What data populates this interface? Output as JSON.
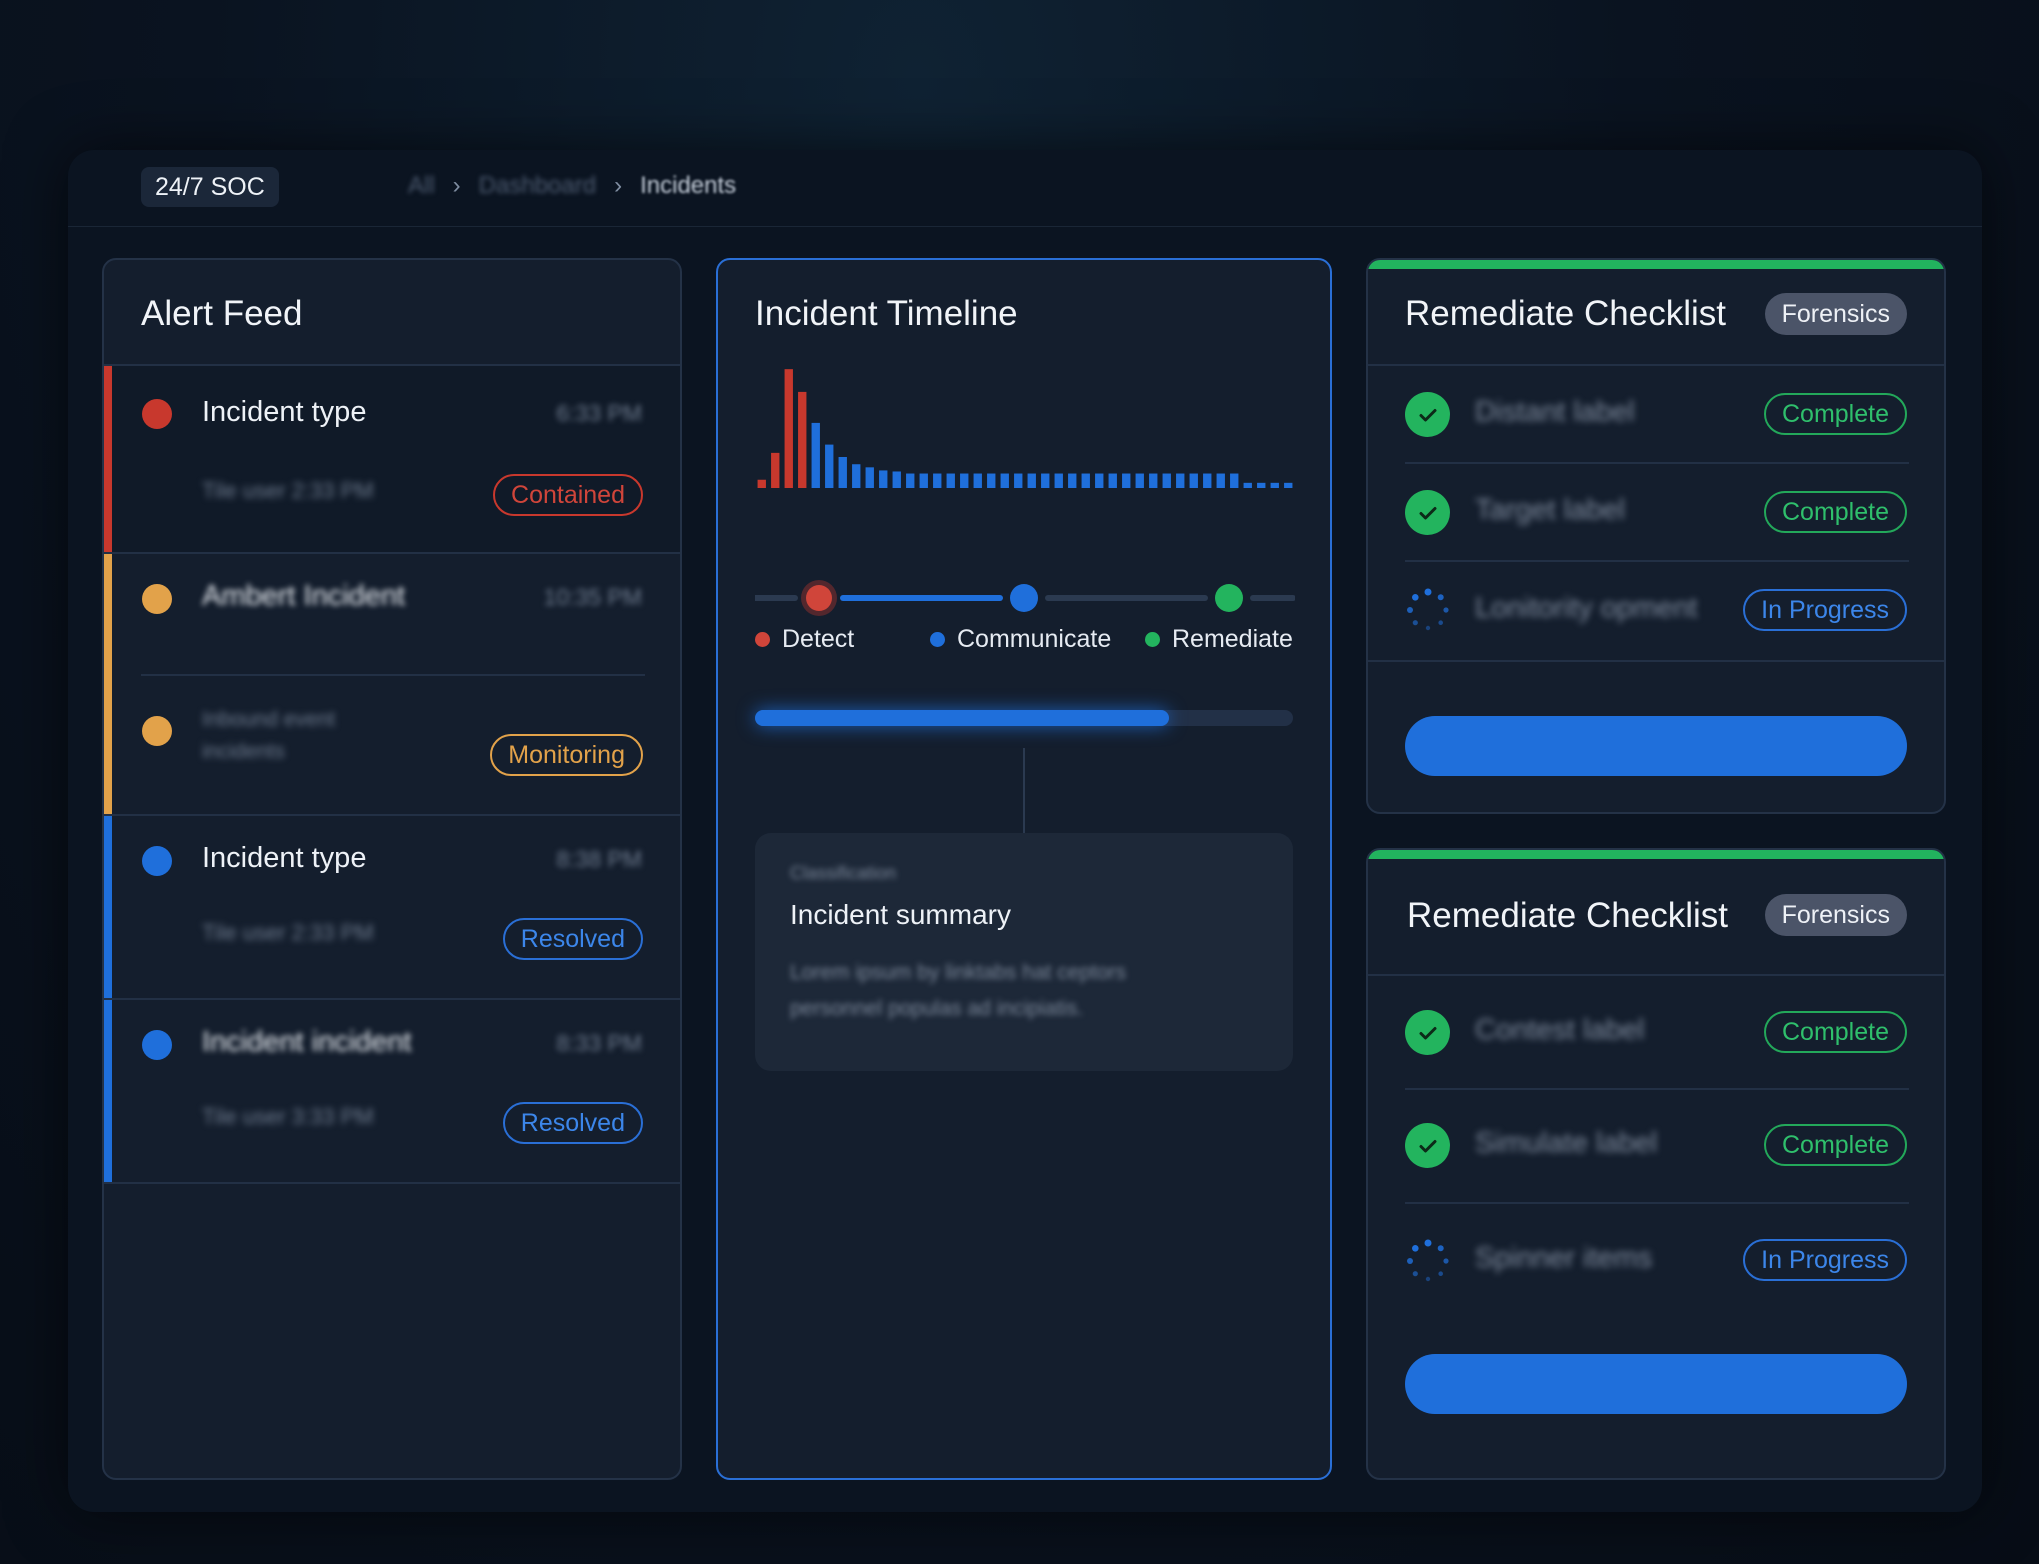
{
  "header": {
    "brand": "24/7 SOC",
    "breadcrumb": [
      "All",
      "Dashboard",
      "Incidents"
    ]
  },
  "alert_feed": {
    "title": "Alert Feed",
    "items": [
      {
        "title": "Incident type",
        "time": "6:33 PM",
        "subtitle": "Tile user 2:33 PM",
        "status": "Contained",
        "color": "#c8382d",
        "status_color": "#d0453a"
      },
      {
        "title": "Ambert Incident",
        "time": "10:35 PM",
        "subtitle": "",
        "status": "",
        "color": "#e2a24a",
        "status_color": "#e2a24a"
      },
      {
        "title": "",
        "time": "",
        "subtitle": "Inbound event incidents",
        "status": "Monitoring",
        "color": "#e2a24a",
        "status_color": "#e2a24a"
      },
      {
        "title": "Incident type",
        "time": "8:38 PM",
        "subtitle": "Tile user 2:33 PM",
        "status": "Resolved",
        "color": "#1f6fdb",
        "status_color": "#3c86ea"
      },
      {
        "title": "Incident incident",
        "time": "8:33 PM",
        "subtitle": "Tile user 3:33 PM",
        "status": "Resolved",
        "color": "#1f6fdb",
        "status_color": "#3c86ea"
      }
    ]
  },
  "timeline": {
    "title": "Incident Timeline",
    "legend": [
      {
        "label": "Detect",
        "color": "#d0453a"
      },
      {
        "label": "Communicate",
        "color": "#1f6fdb"
      },
      {
        "label": "Remediate",
        "color": "#23b45e"
      }
    ],
    "progress": 0.77,
    "summary_kicker": "Classification",
    "summary_title": "Incident summary",
    "summary_body": "Lorem ipsum by linktabs hat ceptors personnel populas ad incipiatis."
  },
  "chart_data": {
    "type": "bar",
    "series": [
      {
        "values": [
          0.8,
          3.4,
          11.5,
          9.3,
          6.3,
          4.2,
          3.0,
          2.3,
          2.0,
          1.7,
          1.6,
          1.4,
          1.4,
          1.4,
          1.4,
          1.4,
          1.4,
          1.4,
          1.4,
          1.4,
          1.4,
          1.4,
          1.4,
          1.4,
          1.4,
          1.4,
          1.4,
          1.4,
          1.4,
          1.4,
          1.4,
          1.4,
          1.4,
          1.4,
          1.4,
          1.4,
          0.5,
          0.5,
          0.5,
          0.5
        ]
      }
    ],
    "highlight_count": 4,
    "colors": {
      "highlight": "#c8382d",
      "normal": "#1f6fdb"
    },
    "ylim": [
      0,
      12
    ]
  },
  "checklists": [
    {
      "title": "Remediate Checklist",
      "tag": "Forensics",
      "items": [
        {
          "label": "Distant label",
          "status": "Complete",
          "state": "done"
        },
        {
          "label": "Target label",
          "status": "Complete",
          "state": "done"
        },
        {
          "label": "Lonitority opment",
          "status": "In Progress",
          "state": "progress"
        }
      ]
    },
    {
      "title": "Remediate Checklist",
      "tag": "Forensics",
      "items": [
        {
          "label": "Contest label",
          "status": "Complete",
          "state": "done"
        },
        {
          "label": "Simulate label",
          "status": "Complete",
          "state": "done"
        },
        {
          "label": "Spinner items",
          "status": "In Progress",
          "state": "progress"
        }
      ]
    }
  ],
  "colors": {
    "complete": "#2fbf6c",
    "in_progress": "#3c86ea",
    "accent": "#1f6fdb"
  }
}
